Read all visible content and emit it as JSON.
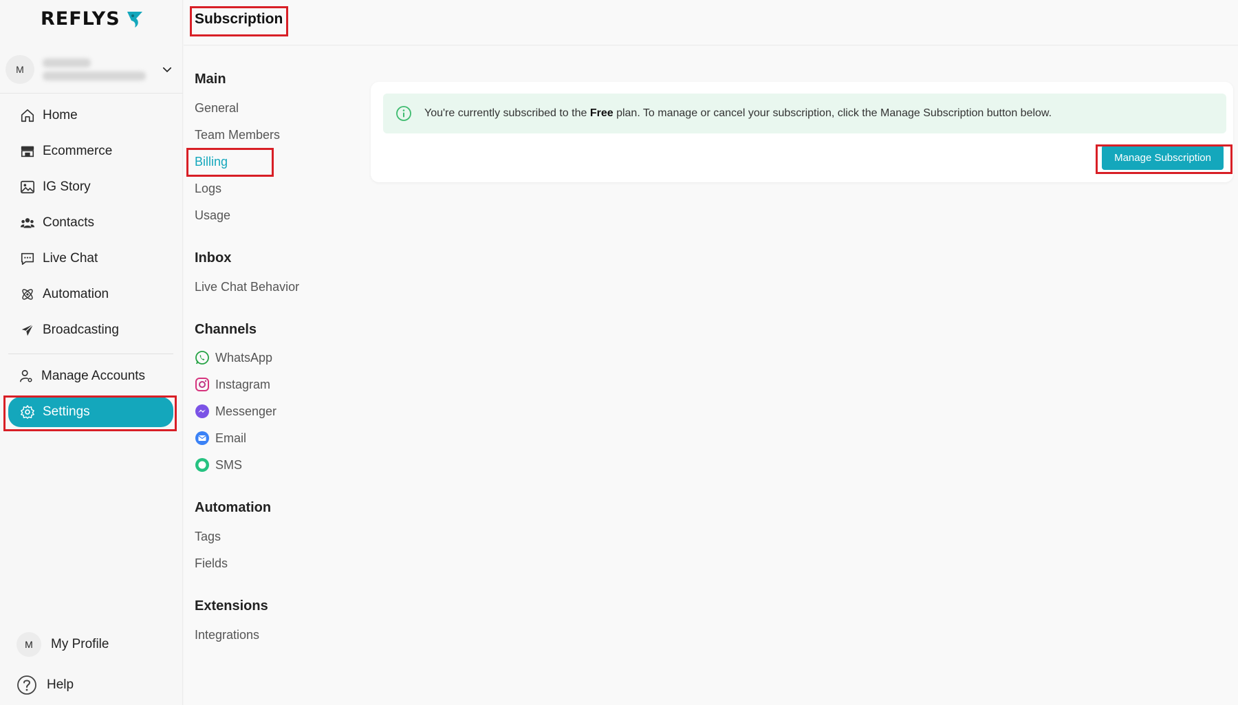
{
  "brand": {
    "name": "REFLYS",
    "accent_color": "#14a7bc"
  },
  "account": {
    "avatar_initial": "M"
  },
  "sidebar": {
    "items": [
      {
        "label": "Home",
        "icon": "home-icon"
      },
      {
        "label": "Ecommerce",
        "icon": "store-icon"
      },
      {
        "label": "IG Story",
        "icon": "image-icon"
      },
      {
        "label": "Contacts",
        "icon": "contacts-icon"
      },
      {
        "label": "Live Chat",
        "icon": "chat-icon"
      },
      {
        "label": "Automation",
        "icon": "automation-icon"
      },
      {
        "label": "Broadcasting",
        "icon": "send-icon"
      }
    ],
    "secondary": [
      {
        "label": "Manage Accounts",
        "icon": "user-cog-icon"
      },
      {
        "label": "Settings",
        "icon": "gear-icon",
        "active": true
      }
    ],
    "bottom": {
      "profile_initial": "M",
      "profile_label": "My Profile",
      "help_label": "Help"
    }
  },
  "header": {
    "title": "Subscription"
  },
  "settings_menu": {
    "sections": [
      {
        "title": "Main",
        "items": [
          "General",
          "Team Members",
          "Billing",
          "Logs",
          "Usage"
        ],
        "active": "Billing"
      },
      {
        "title": "Inbox",
        "items": [
          "Live Chat Behavior"
        ]
      },
      {
        "title": "Channels",
        "items": [
          "WhatsApp",
          "Instagram",
          "Messenger",
          "Email",
          "SMS"
        ]
      },
      {
        "title": "Automation",
        "items": [
          "Tags",
          "Fields"
        ]
      },
      {
        "title": "Extensions",
        "items": [
          "Integrations"
        ]
      }
    ]
  },
  "subscription": {
    "notice_prefix": "You're currently subscribed to the",
    "plan_name": "Free",
    "notice_suffix": "plan. To manage or cancel your subscription, click the Manage Subscription button below.",
    "button_label": "Manage Subscription"
  },
  "colors": {
    "highlight": "#d81f26",
    "notice_bg": "#e9f7ef",
    "info_icon": "#3dbb6e"
  }
}
